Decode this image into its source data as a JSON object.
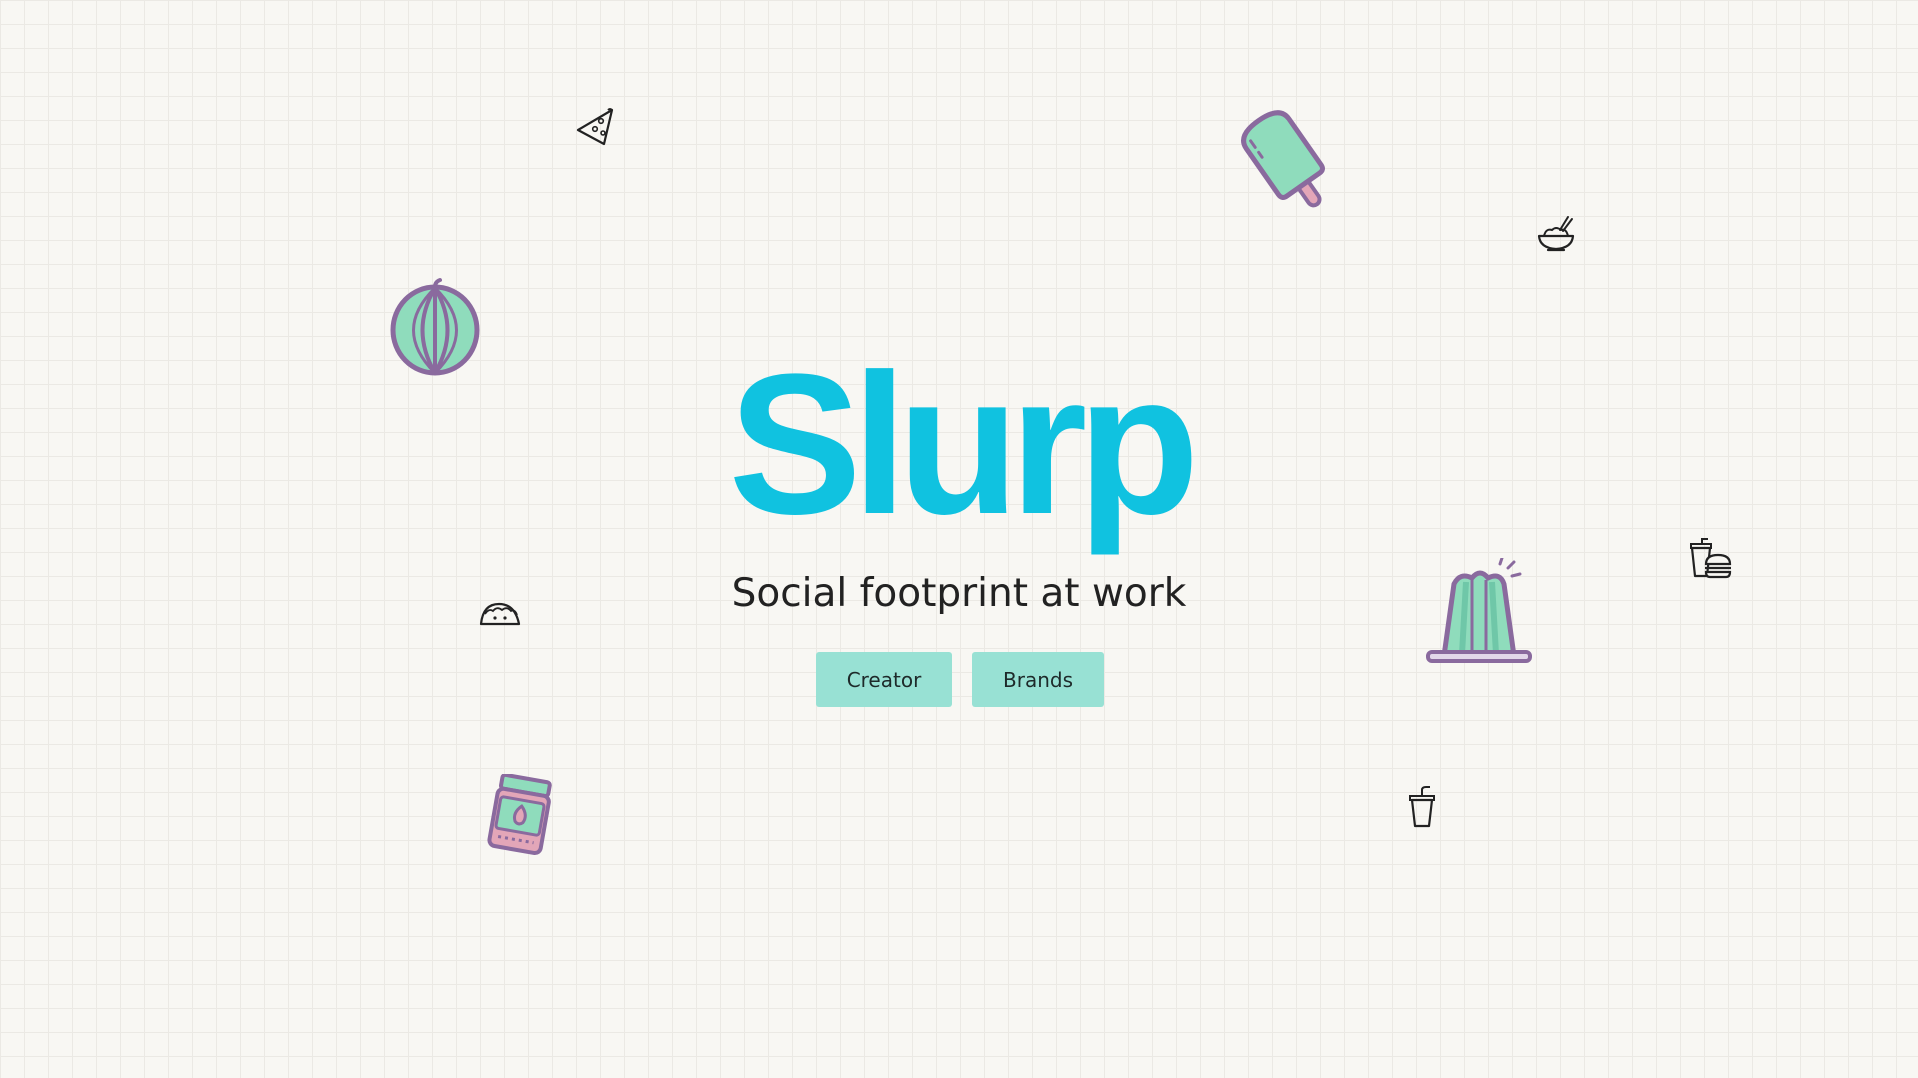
{
  "hero": {
    "logo": "Slurp",
    "tagline": "Social footprint at work"
  },
  "actions": {
    "creator_label": "Creator",
    "brands_label": "Brands"
  },
  "decorations": [
    "pizza-slice-icon",
    "popsicle-icon",
    "noodle-bowl-icon",
    "watermelon-icon",
    "taco-icon",
    "jelly-pudding-icon",
    "burger-and-drink-icon",
    "jam-jar-icon",
    "drink-cup-icon"
  ],
  "colors": {
    "background": "#f8f7f3",
    "grid": "#ebe9e4",
    "logo": "#10c2e0",
    "button": "#98e1d4",
    "mint": "#8fdcbc",
    "purple_outline": "#8a6a9e",
    "pink": "#e3a6b8"
  }
}
